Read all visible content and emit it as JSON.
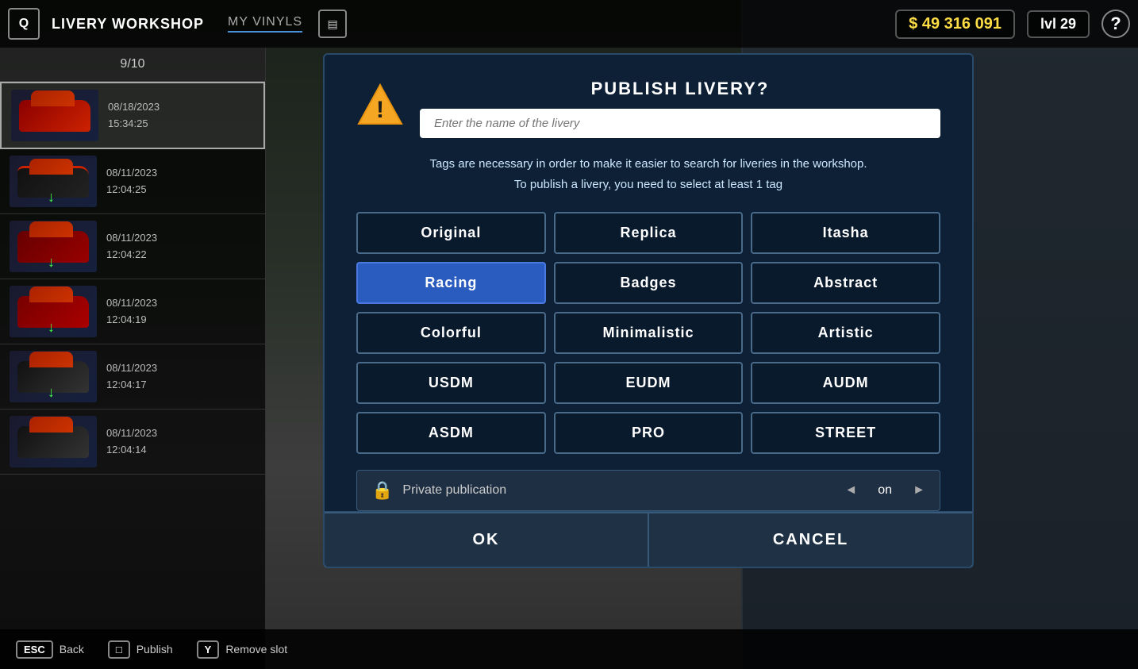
{
  "app": {
    "title": "LIVERY WORKSHOP",
    "nav": "MY VINYLS",
    "currency": "$ 49 316 091",
    "level": "lvl 29",
    "help": "?"
  },
  "left_panel": {
    "header": "9/10",
    "items": [
      {
        "date": "08/18/2023",
        "time": "15:34:25",
        "active": true,
        "has_download": false
      },
      {
        "date": "08/11/2023",
        "time": "12:04:25",
        "active": false,
        "has_download": true
      },
      {
        "date": "08/11/2023",
        "time": "12:04:22",
        "active": false,
        "has_download": true
      },
      {
        "date": "08/11/2023",
        "time": "12:04:19",
        "active": false,
        "has_download": true
      },
      {
        "date": "08/11/2023",
        "time": "12:04:17",
        "active": false,
        "has_download": true
      },
      {
        "date": "08/11/2023",
        "time": "12:04:14",
        "active": false,
        "has_download": false
      }
    ]
  },
  "modal": {
    "title": "PUBLISH LIVERY?",
    "name_placeholder": "Enter the name of the livery",
    "description_line1": "Tags are necessary in order to make it easier to search for liveries in the workshop.",
    "description_line2": "To publish a livery, you need to select at least 1 tag",
    "tags": [
      {
        "label": "Original",
        "selected": false
      },
      {
        "label": "Replica",
        "selected": false
      },
      {
        "label": "Itasha",
        "selected": false
      },
      {
        "label": "Racing",
        "selected": true
      },
      {
        "label": "Badges",
        "selected": false
      },
      {
        "label": "Abstract",
        "selected": false
      },
      {
        "label": "Colorful",
        "selected": false
      },
      {
        "label": "Minimalistic",
        "selected": false
      },
      {
        "label": "Artistic",
        "selected": false
      },
      {
        "label": "USDM",
        "selected": false
      },
      {
        "label": "EUDM",
        "selected": false
      },
      {
        "label": "AUDM",
        "selected": false
      },
      {
        "label": "ASDM",
        "selected": false
      },
      {
        "label": "PRO",
        "selected": false
      },
      {
        "label": "STREET",
        "selected": false
      }
    ],
    "private_label": "Private publication",
    "private_value": "on",
    "ok_label": "OK",
    "cancel_label": "CANCEL"
  },
  "bottom_bar": {
    "keys": [
      {
        "key": "ESC",
        "label": "Back"
      },
      {
        "key": "□",
        "label": "Publish"
      },
      {
        "key": "Y",
        "label": "Remove slot"
      }
    ]
  }
}
